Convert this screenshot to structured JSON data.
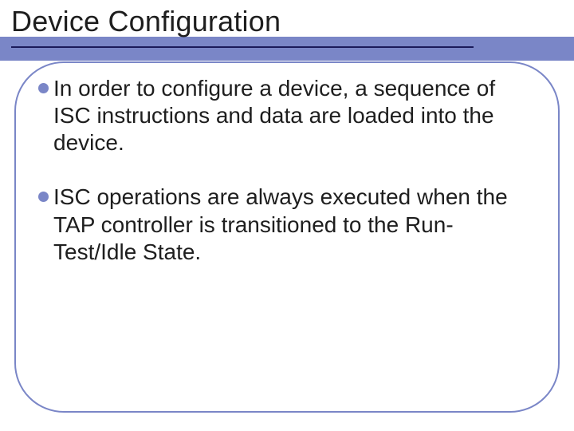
{
  "slide": {
    "title": "Device Configuration",
    "bullets": [
      {
        "text": "In order to configure a device, a sequence of ISC instructions and data are loaded into the device."
      },
      {
        "text": "ISC operations are always executed when the TAP controller is transitioned to the Run-Test/Idle State."
      }
    ]
  },
  "colors": {
    "accent": "#7a86c7",
    "underline": "#1a1a5a",
    "text": "#1e1e1e"
  }
}
